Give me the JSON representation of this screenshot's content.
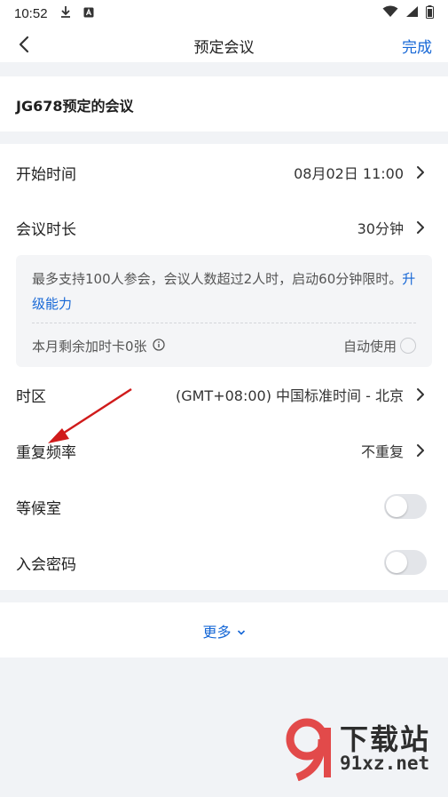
{
  "status_bar": {
    "time": "10:52"
  },
  "nav": {
    "title": "预定会议",
    "done": "完成"
  },
  "topic": "JG678预定的会议",
  "rows": {
    "start": {
      "label": "开始时间",
      "value": "08月02日 11:00"
    },
    "duration": {
      "label": "会议时长",
      "value": "30分钟"
    },
    "timezone": {
      "label": "时区",
      "value": "(GMT+08:00) 中国标准时间 - 北京"
    },
    "repeat": {
      "label": "重复频率",
      "value": "不重复"
    },
    "waiting_room": {
      "label": "等候室",
      "enabled": false
    },
    "password": {
      "label": "入会密码",
      "enabled": false
    }
  },
  "info": {
    "text": "最多支持100人参会，会议人数超过2人时，启动60分钟限时。",
    "link": "升级能力",
    "card_label": "本月剩余加时卡0张",
    "auto_use": "自动使用"
  },
  "more": "更多",
  "watermark": {
    "brand": "下载站",
    "url": "91xz.net"
  },
  "colors": {
    "accent": "#1667d6",
    "annotation_arrow": "#d01b1b",
    "background": "#f1f3f6"
  }
}
